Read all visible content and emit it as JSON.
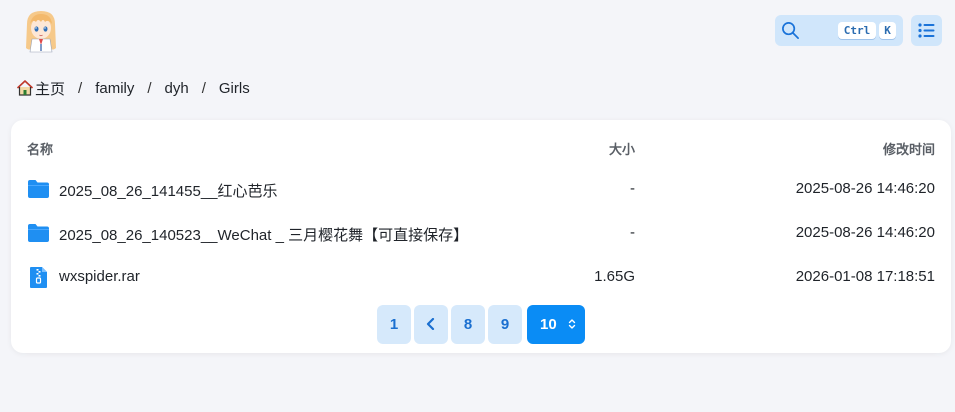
{
  "header": {
    "search": {
      "key1": "Ctrl",
      "key2": "K"
    }
  },
  "breadcrumb": [
    {
      "label": "主页"
    },
    {
      "label": "family"
    },
    {
      "label": "dyh"
    },
    {
      "label": "Girls"
    }
  ],
  "breadcrumb_separator": "/",
  "table": {
    "headers": {
      "name": "名称",
      "size": "大小",
      "modified": "修改时间"
    },
    "rows": [
      {
        "icon": "folder-icon",
        "name": "2025_08_26_141455__红心芭乐",
        "size": "-",
        "modified": "2025-08-26 14:46:20"
      },
      {
        "icon": "folder-icon",
        "name": "2025_08_26_140523__WeChat _ 三月樱花舞【可直接保存】",
        "size": "-",
        "modified": "2025-08-26 14:46:20"
      },
      {
        "icon": "archive-file-icon",
        "name": "wxspider.rar",
        "size": "1.65G",
        "modified": "2026-01-08 17:18:51"
      }
    ]
  },
  "pagination": {
    "first": "1",
    "prev": "‹",
    "pages": [
      "8",
      "9"
    ],
    "current": "10"
  },
  "colors": {
    "accent": "#0a8cf5",
    "folder": "#1f8ff2",
    "button_bg": "#d6e9fb",
    "page_bg": "#f4f5f9"
  }
}
